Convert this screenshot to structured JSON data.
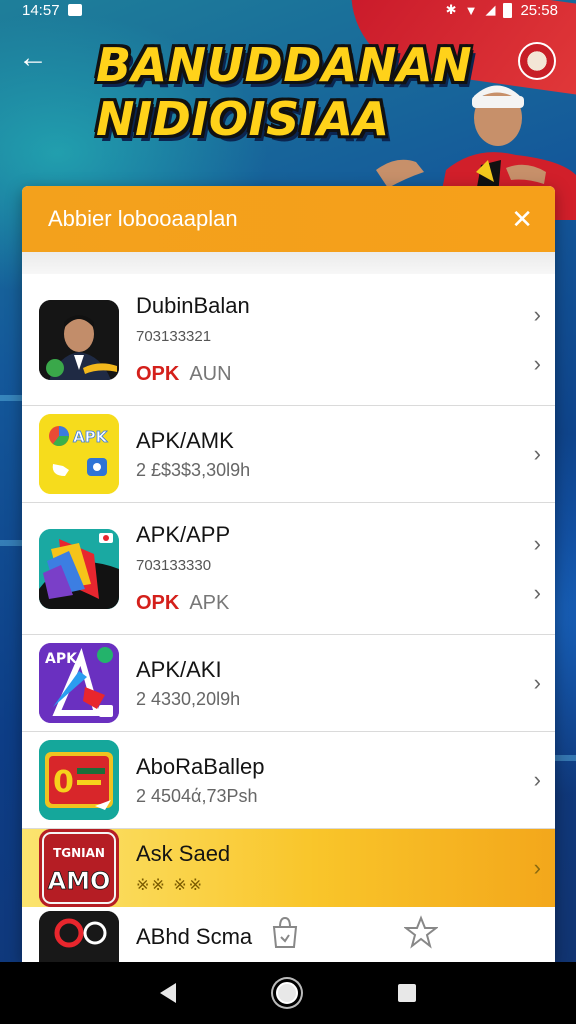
{
  "status_bar": {
    "time": "14:57",
    "right_text": "25:58"
  },
  "header": {
    "back_label": "←",
    "banner_line1": "BANUDDANAN",
    "banner_line2": "NIDIOISIAA"
  },
  "panel": {
    "title": "Abbier lobooaaplan",
    "close_label": "✕"
  },
  "apps": [
    {
      "name": "DubinBalan",
      "sub": "703133321",
      "tag_red": "OPK",
      "tag_gray": "AUN"
    },
    {
      "name": "APK/AMK",
      "meta": "2 £$3$3,30l9h"
    },
    {
      "name": "APK/APP",
      "sub": "703133330",
      "tag_red": "OPK",
      "tag_gray": "APK"
    },
    {
      "name": "APK/AKI",
      "meta": "2 4330,20l9h"
    },
    {
      "name": "AboRaBallep",
      "meta": "2 4504ά,73Psh"
    },
    {
      "name": "Ask Saed",
      "meta": "※※ ※※"
    },
    {
      "name": "ABhd Scma"
    }
  ],
  "icons": {
    "app3_text": "APK",
    "app4_text": "APK",
    "app6_line1": "TGNIAN",
    "app6_line2": "AMO"
  },
  "colors": {
    "header_orange": "#f3a11c",
    "highlight_yellow": "#f9c52a",
    "tag_red": "#d4201b",
    "banner_yellow": "#ffd21a"
  }
}
